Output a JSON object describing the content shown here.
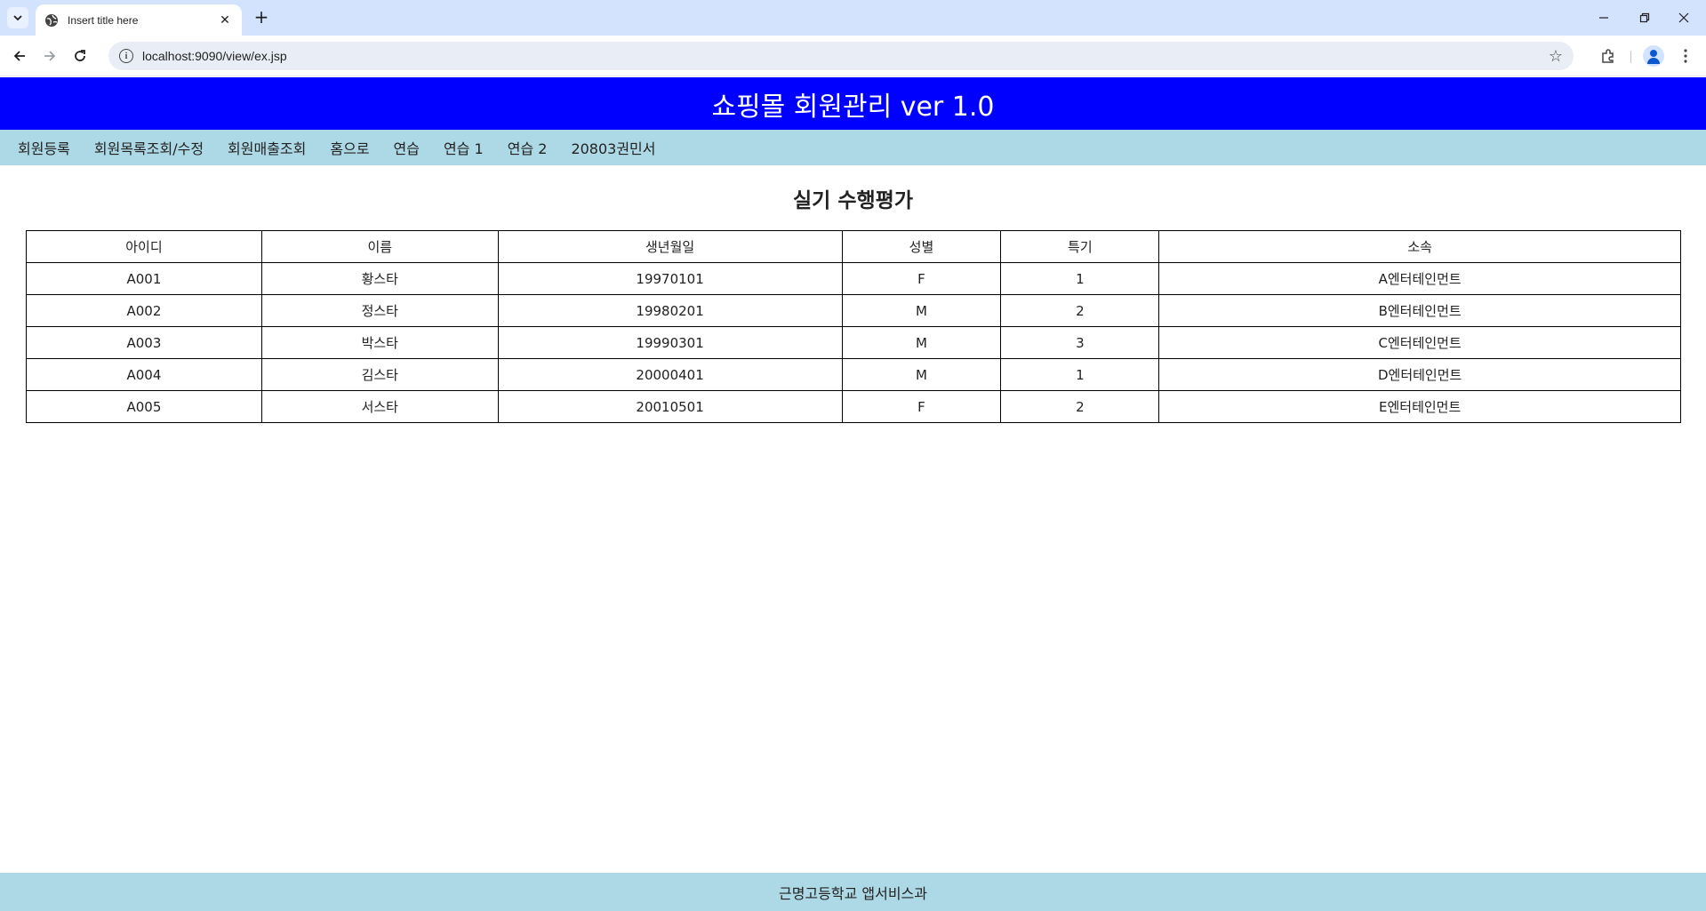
{
  "browser": {
    "tab_title": "Insert title here",
    "tab_close": "✕",
    "new_tab": "+",
    "url": "localhost:9090/view/ex.jsp",
    "icons": [
      "tab-search-icon",
      "globe-icon",
      "back-icon",
      "forward-icon",
      "reload-icon",
      "info-icon",
      "star-icon",
      "extensions-icon",
      "profile-icon",
      "menu-icon",
      "minimize-icon",
      "restore-icon",
      "close-icon"
    ]
  },
  "header": {
    "title": "쇼핑몰 회원관리 ver 1.0"
  },
  "nav": {
    "items": [
      "회원등록",
      "회원목록조회/수정",
      "회원매출조회",
      "홈으로",
      "연습",
      "연습 1",
      "연습 2",
      "20803권민서"
    ]
  },
  "main": {
    "title": "실기 수행평가",
    "table": {
      "columns": [
        "아이디",
        "이름",
        "생년월일",
        "성별",
        "특기",
        "소속"
      ],
      "rows": [
        [
          "A001",
          "황스타",
          "19970101",
          "F",
          "1",
          "A엔터테인먼트"
        ],
        [
          "A002",
          "정스타",
          "19980201",
          "M",
          "2",
          "B엔터테인먼트"
        ],
        [
          "A003",
          "박스타",
          "19990301",
          "M",
          "3",
          "C엔터테인먼트"
        ],
        [
          "A004",
          "김스타",
          "20000401",
          "M",
          "1",
          "D엔터테인먼트"
        ],
        [
          "A005",
          "서스타",
          "20010501",
          "F",
          "2",
          "E엔터테인먼트"
        ]
      ]
    }
  },
  "footer": {
    "text": "근명고등학교 앱서비스과"
  },
  "colors": {
    "header_bg": "#0000ff",
    "nav_bg": "#add8e6",
    "footer_bg": "#add8e6",
    "chrome_bg": "#d3e3fd"
  }
}
